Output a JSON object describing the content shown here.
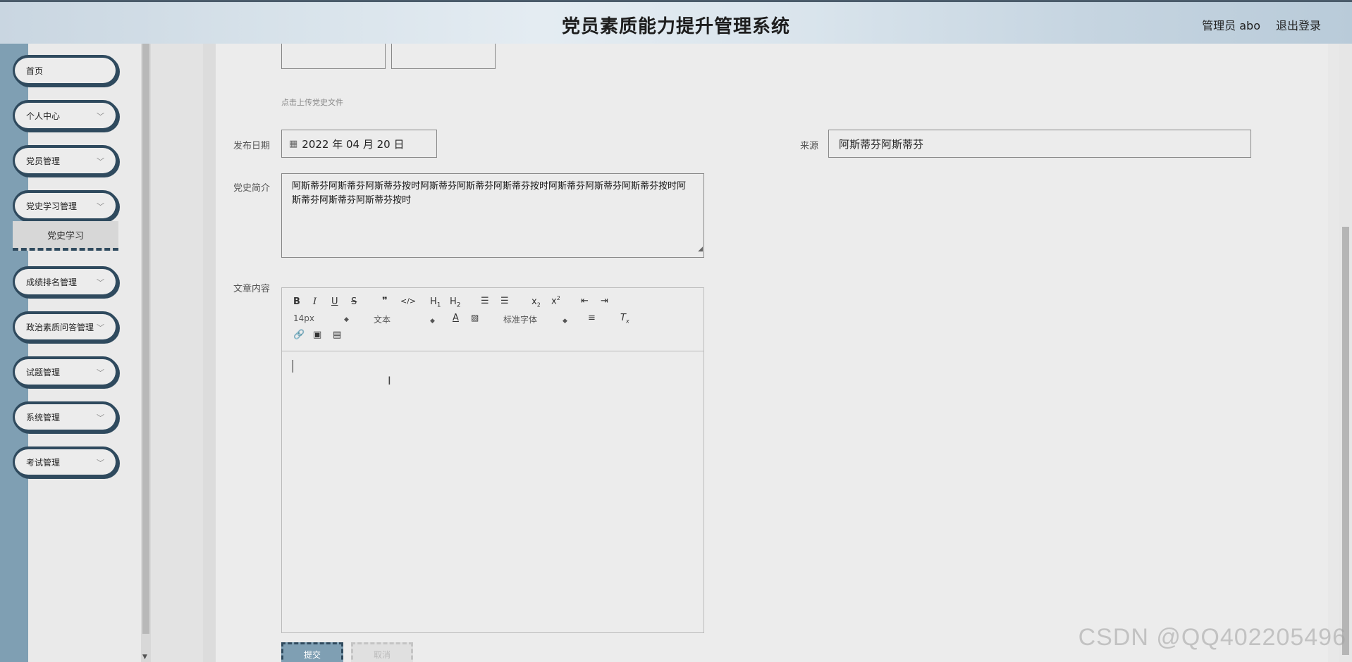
{
  "header": {
    "title": "党员素质能力提升管理系统",
    "user": "管理员 abo",
    "logout": "退出登录"
  },
  "sidebar": {
    "items": [
      {
        "label": "首页",
        "has_chevron": false
      },
      {
        "label": "个人中心",
        "has_chevron": true
      },
      {
        "label": "党员管理",
        "has_chevron": true
      },
      {
        "label": "党史学习管理",
        "has_chevron": true
      },
      {
        "label": "成绩排名管理",
        "has_chevron": true
      },
      {
        "label": "政治素质问答管理",
        "has_chevron": true
      },
      {
        "label": "试题管理",
        "has_chevron": true
      },
      {
        "label": "系统管理",
        "has_chevron": true
      },
      {
        "label": "考试管理",
        "has_chevron": true
      }
    ],
    "active_submenu": "党史学习"
  },
  "form": {
    "upload_hint": "点击上传党史文件",
    "date_label": "发布日期",
    "date_value": "2022 年 04 月 20 日",
    "source_label": "来源",
    "source_value": "阿斯蒂芬阿斯蒂芬",
    "intro_label": "党史简介",
    "intro_value": "阿斯蒂芬阿斯蒂芬阿斯蒂芬按时阿斯蒂芬阿斯蒂芬阿斯蒂芬按时阿斯蒂芬阿斯蒂芬阿斯蒂芬按时阿斯蒂芬阿斯蒂芬阿斯蒂芬按时",
    "content_label": "文章内容",
    "editor": {
      "font_size": "14px",
      "block_type": "文本",
      "font_family": "标准字体"
    },
    "submit": "提交",
    "cancel": "取消"
  },
  "watermark": "CSDN @QQ402205496",
  "colors": {
    "accent": "#2f4a5e",
    "sidebar_strip": "#7f9fb3",
    "submit_bg": "#7f9fb3"
  }
}
